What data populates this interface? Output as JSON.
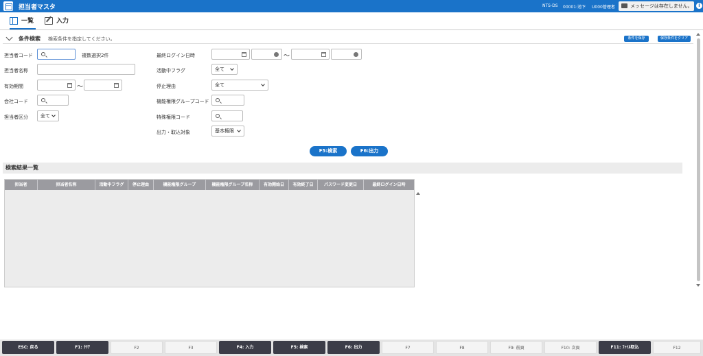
{
  "header": {
    "title": "担当者マスタ",
    "system": "NTS-DS",
    "department": "00001:池下",
    "user": "U000管理者",
    "message": "メッセージは存在しません。"
  },
  "tabs": [
    {
      "label": "一覧",
      "active": true
    },
    {
      "label": "入力",
      "active": false
    }
  ],
  "search": {
    "title": "条件検索",
    "hint": "検索条件を指定してください。",
    "save_label": "条件を保存",
    "clear_saved_label": "保存条件をクリア",
    "fields": {
      "staff_code": {
        "label": "担当者コード",
        "value": "",
        "note": "複数選択2件"
      },
      "staff_name": {
        "label": "担当者名称",
        "value": ""
      },
      "valid_period": {
        "label": "有効期間",
        "from": "",
        "to": ""
      },
      "company_code": {
        "label": "会社コード",
        "value": ""
      },
      "staff_type": {
        "label": "担当者区分",
        "value": "全て"
      },
      "last_login": {
        "label": "最終ログイン日時",
        "from_date": "",
        "from_time": "",
        "to_date": "",
        "to_time": ""
      },
      "active_flag": {
        "label": "活動中フラグ",
        "value": "全て"
      },
      "stop_reason": {
        "label": "停止理由",
        "value": "全て"
      },
      "func_group_code": {
        "label": "機能権限グループコード",
        "value": ""
      },
      "special_code": {
        "label": "特殊権限コード",
        "value": ""
      },
      "output_target": {
        "label": "出力・取込対象",
        "value": "基本権限"
      }
    },
    "tilde": "～",
    "search_button": "F5:検索",
    "output_button": "F6:出力"
  },
  "results": {
    "title": "検索結果一覧",
    "columns": [
      "担当者",
      "担当者名称",
      "活動中フラグ",
      "停止理由",
      "機能権限グループ",
      "機能権限グループ名称",
      "有効開始日",
      "有効終了日",
      "パスワード変更日",
      "最終ログイン日時"
    ]
  },
  "function_keys": [
    {
      "label": "ESC: 戻る",
      "enabled": true
    },
    {
      "label": "F1: ｸﾘｱ",
      "enabled": true
    },
    {
      "label": "F2",
      "enabled": false
    },
    {
      "label": "F3",
      "enabled": false
    },
    {
      "label": "F4: 入力",
      "enabled": true
    },
    {
      "label": "F5: 検索",
      "enabled": true
    },
    {
      "label": "F6: 出力",
      "enabled": true
    },
    {
      "label": "F7",
      "enabled": false
    },
    {
      "label": "F8",
      "enabled": false
    },
    {
      "label": "F9: 前頁",
      "enabled": false
    },
    {
      "label": "F10: 次頁",
      "enabled": false
    },
    {
      "label": "F11: ﾌｧｲﾙ取込",
      "enabled": true
    },
    {
      "label": "F12",
      "enabled": false
    }
  ],
  "colors": {
    "primary": "#1a73c9",
    "fkey_active": "#3c3d48",
    "grid_header": "#9b9ba0"
  }
}
